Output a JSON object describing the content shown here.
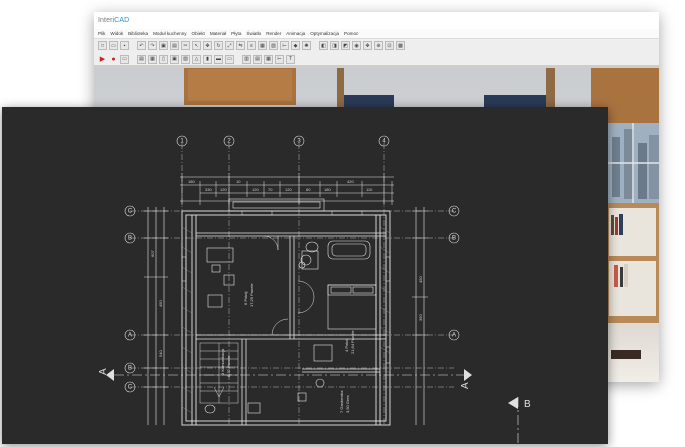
{
  "app": {
    "logo_prefix": "Interi",
    "logo_suffix": "CAD",
    "menu": [
      "Plik",
      "Widok",
      "Biblioteka",
      "Moduł kuchenny",
      "Obiekt",
      "Materiał",
      "Płyta",
      "Światło",
      "Render",
      "Animacja",
      "Optymalizacja",
      "Pomoc"
    ]
  },
  "plan": {
    "axis_top": [
      "1",
      "2",
      "3",
      "4"
    ],
    "axis_left": [
      "C",
      "B",
      "A",
      "B",
      "C"
    ],
    "axis_right": [
      "C",
      "B",
      "A"
    ],
    "section_left": "A",
    "section_right": "A",
    "section_bottom": "B",
    "dim_top": [
      "180",
      "330",
      "120",
      "10",
      "120",
      "70",
      "120",
      "60",
      "180",
      "420",
      "110"
    ],
    "dim_left": [
      "607",
      "450",
      "540"
    ],
    "dim_right": [
      "450",
      "350"
    ],
    "rooms": [
      {
        "name": "6 Pokój",
        "area": "17,25 Panele"
      },
      {
        "name": "4 Pokój",
        "area": "21,64 Panele"
      },
      {
        "name": "3 Komunikacja",
        "area": "8,32 Panele"
      },
      {
        "name": "7 Garderoba",
        "area": "3,50 Gres"
      }
    ]
  },
  "colors": {
    "cad_background": "#2a2a2a",
    "cad_lines": "#e6e6e6",
    "app_accent": "#2f8fd0",
    "record_red": "#d12020"
  }
}
